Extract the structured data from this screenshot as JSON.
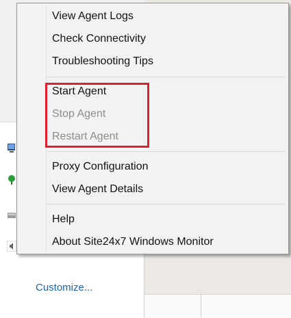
{
  "menu": {
    "items": [
      {
        "label": "View Agent Logs",
        "enabled": true
      },
      {
        "label": "Check Connectivity",
        "enabled": true
      },
      {
        "label": "Troubleshooting Tips",
        "enabled": true
      },
      {
        "label": "Start Agent",
        "enabled": true
      },
      {
        "label": "Stop Agent",
        "enabled": false
      },
      {
        "label": "Restart Agent",
        "enabled": false
      },
      {
        "label": "Proxy Configuration",
        "enabled": true
      },
      {
        "label": "View Agent Details",
        "enabled": true
      },
      {
        "label": "Help",
        "enabled": true
      },
      {
        "label": "About Site24x7 Windows Monitor",
        "enabled": true
      }
    ]
  },
  "tray": {
    "customize_label": "Customize...",
    "icons": [
      "monitor-icon",
      "network-icon",
      "drive-icon",
      "speaker-icon"
    ]
  },
  "colors": {
    "highlight_border": "#e0202d",
    "link": "#1a64b4",
    "disabled_text": "#8c8c8c"
  }
}
